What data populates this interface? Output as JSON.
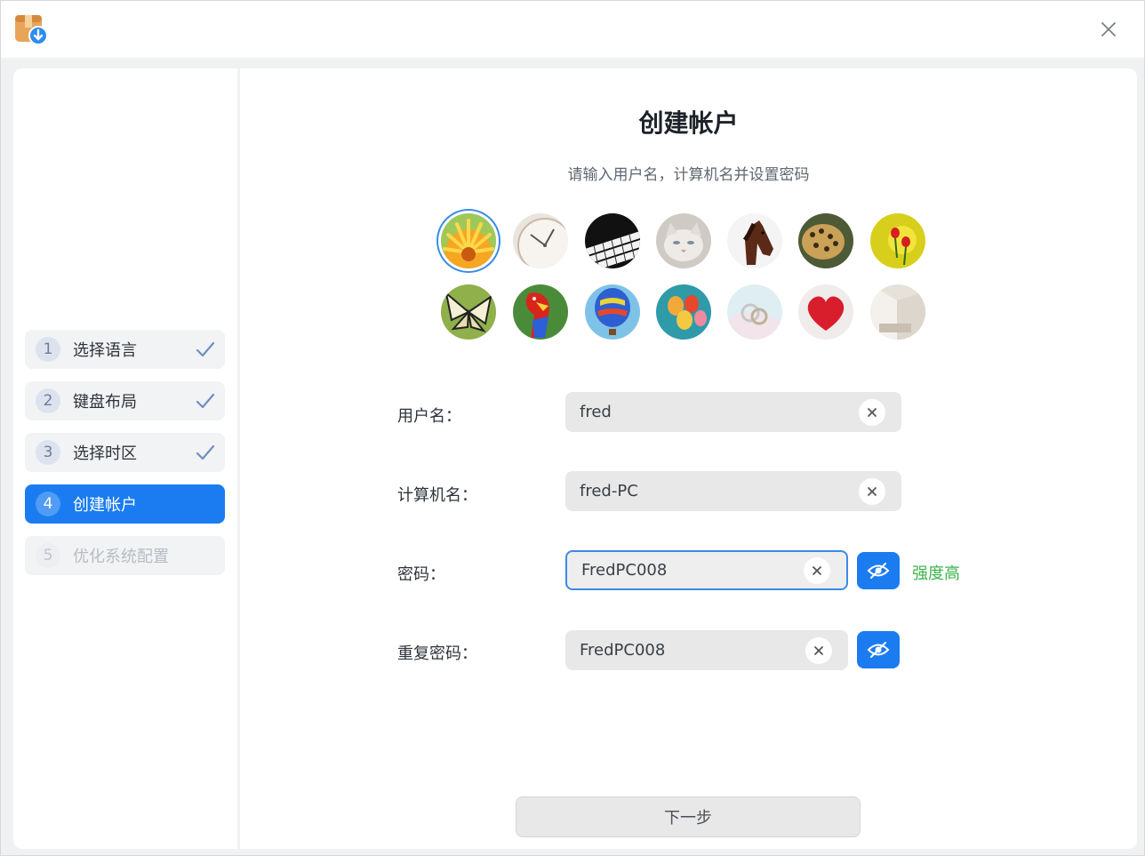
{
  "window": {
    "app_icon": "installer-package-icon",
    "close_icon": "close-icon"
  },
  "sidebar": {
    "steps": [
      {
        "number": "1",
        "label": "选择语言",
        "state": "done"
      },
      {
        "number": "2",
        "label": "键盘布局",
        "state": "done"
      },
      {
        "number": "3",
        "label": "选择时区",
        "state": "done"
      },
      {
        "number": "4",
        "label": "创建帐户",
        "state": "active"
      },
      {
        "number": "5",
        "label": "优化系统配置",
        "state": "disabled"
      }
    ]
  },
  "main": {
    "title": "创建帐户",
    "subtitle": "请输入用户名，计算机名并设置密码",
    "avatars": [
      {
        "name": "flower-avatar",
        "selected": true
      },
      {
        "name": "clock-avatar",
        "selected": false
      },
      {
        "name": "piano-avatar",
        "selected": false
      },
      {
        "name": "kitten-avatar",
        "selected": false
      },
      {
        "name": "horse-avatar",
        "selected": false
      },
      {
        "name": "leopard-avatar",
        "selected": false
      },
      {
        "name": "ladybug-avatar",
        "selected": false
      },
      {
        "name": "butterfly-avatar",
        "selected": false
      },
      {
        "name": "parrot-avatar",
        "selected": false
      },
      {
        "name": "hot-air-balloon-avatar",
        "selected": false
      },
      {
        "name": "balloons-avatar",
        "selected": false
      },
      {
        "name": "rings-avatar",
        "selected": false
      },
      {
        "name": "heart-avatar",
        "selected": false
      },
      {
        "name": "room-avatar",
        "selected": false
      }
    ],
    "form": {
      "username": {
        "label": "用户名：",
        "value": "fred"
      },
      "hostname": {
        "label": "计算机名：",
        "value": "fred-PC"
      },
      "password": {
        "label": "密码：",
        "value": "FredPC008"
      },
      "repeat_password": {
        "label": "重复密码：",
        "value": "FredPC008"
      },
      "strength": "强度高"
    },
    "next_button": "下一步"
  },
  "colors": {
    "accent": "#1a7cf0",
    "strength": "#3bb54a",
    "focus_border": "#3b8be8"
  }
}
